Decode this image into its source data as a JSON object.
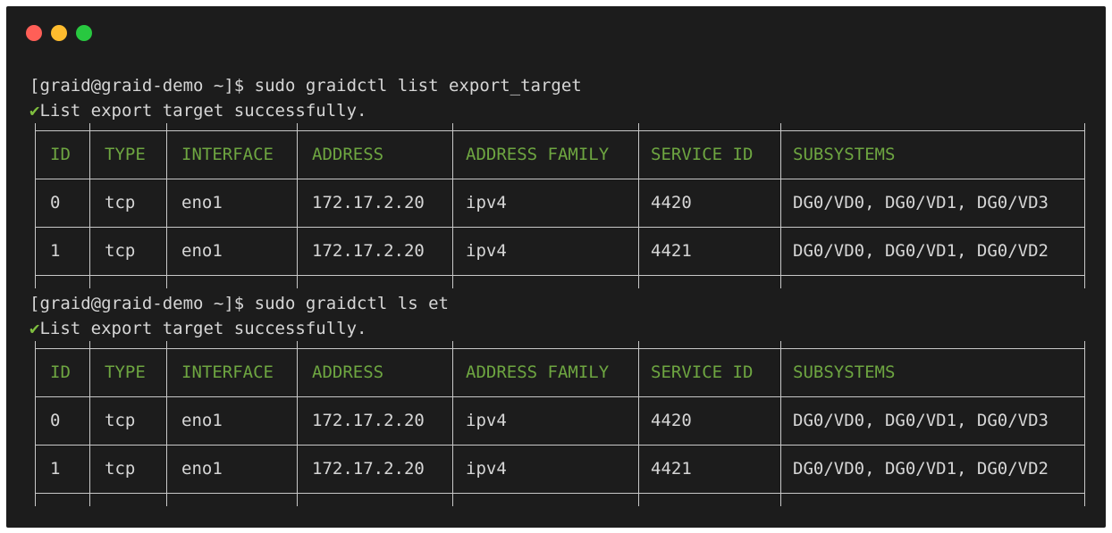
{
  "window_controls": [
    "close",
    "minimize",
    "maximize"
  ],
  "block1": {
    "prompt": "[graid@graid-demo ~]$ sudo graidctl list export_target",
    "status_mark": "✔",
    "status_text": "List export target successfully."
  },
  "block2": {
    "prompt": "[graid@graid-demo ~]$ sudo graidctl ls et",
    "status_mark": "✔",
    "status_text": "List export target successfully."
  },
  "table": {
    "headers": [
      "ID",
      "TYPE",
      "INTERFACE",
      "ADDRESS",
      "ADDRESS FAMILY",
      "SERVICE ID",
      "SUBSYSTEMS"
    ],
    "rows": [
      [
        "0",
        "tcp",
        "eno1",
        "172.17.2.20",
        "ipv4",
        "4420",
        "DG0/VD0, DG0/VD1, DG0/VD3"
      ],
      [
        "1",
        "tcp",
        "eno1",
        "172.17.2.20",
        "ipv4",
        "4421",
        "DG0/VD0, DG0/VD1, DG0/VD2"
      ]
    ]
  },
  "colors": {
    "background": "#1c1c1c",
    "text": "#d6d6d6",
    "header_text": "#6ea641",
    "check": "#7fbf3f"
  }
}
